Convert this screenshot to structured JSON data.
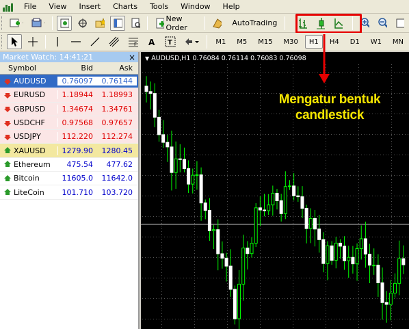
{
  "menu": [
    "File",
    "View",
    "Insert",
    "Charts",
    "Tools",
    "Window",
    "Help"
  ],
  "toolbar": {
    "new_order_label": "New Order",
    "autotrading_label": "AutoTrading"
  },
  "timeframes": [
    "M1",
    "M5",
    "M15",
    "M30",
    "H1",
    "H4",
    "D1",
    "W1",
    "MN"
  ],
  "active_timeframe": "H1",
  "market_watch": {
    "title": "Market Watch: 14:41:21",
    "close": "×",
    "columns": {
      "symbol": "Symbol",
      "bid": "Bid",
      "ask": "Ask"
    },
    "rows": [
      {
        "symbol": "AUDUSD",
        "bid": "0.76097",
        "ask": "0.76144",
        "style": "selected",
        "dir": "down"
      },
      {
        "symbol": "EURUSD",
        "bid": "1.18944",
        "ask": "1.18993",
        "style": "red",
        "dir": "down"
      },
      {
        "symbol": "GBPUSD",
        "bid": "1.34674",
        "ask": "1.34761",
        "style": "red",
        "dir": "down"
      },
      {
        "symbol": "USDCHF",
        "bid": "0.97568",
        "ask": "0.97657",
        "style": "red",
        "dir": "down"
      },
      {
        "symbol": "USDJPY",
        "bid": "112.220",
        "ask": "112.274",
        "style": "red",
        "dir": "down"
      },
      {
        "symbol": "XAUUSD",
        "bid": "1279.90",
        "ask": "1280.45",
        "style": "yellow",
        "dir": "up"
      },
      {
        "symbol": "Ethereum",
        "bid": "475.54",
        "ask": "477.62",
        "style": "blue",
        "dir": "up"
      },
      {
        "symbol": "Bitcoin",
        "bid": "11605.0",
        "ask": "11642.0",
        "style": "blue",
        "dir": "up"
      },
      {
        "symbol": "LiteCoin",
        "bid": "101.710",
        "ask": "103.720",
        "style": "blue",
        "dir": "up"
      }
    ]
  },
  "chart": {
    "header": "AUDUSD,H1  0.76084 0.76114 0.76083 0.76098",
    "candle_color": "#ffffff",
    "wick_color": "#00ff00",
    "bid_line_color": "#bfbfbf",
    "annotation": [
      "Mengatur bentuk",
      "candlestick"
    ],
    "annotation_color": "#f5e600",
    "pointer_color": "#e60000"
  },
  "colors": {
    "highlight": "#e60000",
    "selected_row": "#316ac5",
    "title_bar": "#a6caf0"
  }
}
